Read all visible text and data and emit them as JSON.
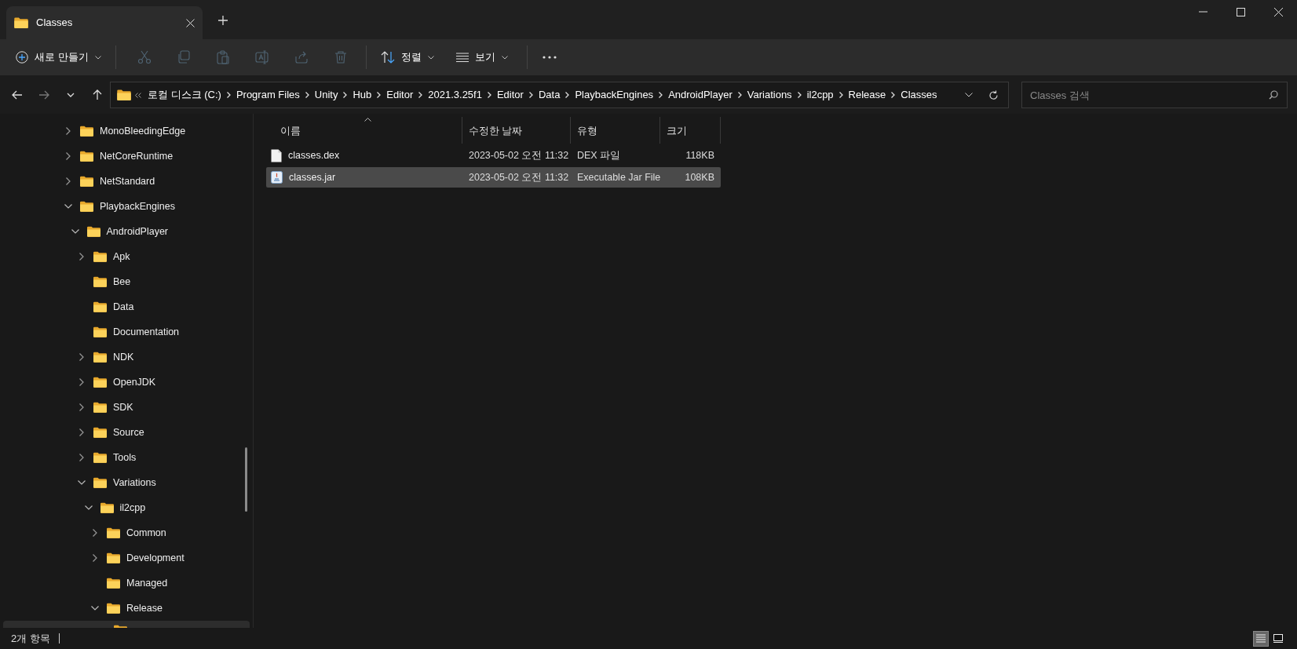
{
  "tabs": [
    {
      "title": "Classes",
      "selected": true
    }
  ],
  "toolbar": {
    "new_button": "새로 만들기",
    "actions": [
      {
        "kind": "cut",
        "disabled": true
      },
      {
        "kind": "copy",
        "disabled": true
      },
      {
        "kind": "paste",
        "disabled": true
      },
      {
        "kind": "rename",
        "disabled": true
      },
      {
        "kind": "share",
        "disabled": true
      },
      {
        "kind": "delete",
        "disabled": true
      }
    ],
    "sort_button": "정렬",
    "view_button": "보기"
  },
  "navigation": {
    "back": {
      "disabled": false
    },
    "forward": {
      "disabled": true
    }
  },
  "address_bar": {
    "crumbs": [
      "로컬 디스크 (C:)",
      "Program Files",
      "Unity",
      "Hub",
      "Editor",
      "2021.3.25f1",
      "Editor",
      "Data",
      "PlaybackEngines",
      "AndroidPlayer",
      "Variations",
      "il2cpp",
      "Release",
      "Classes"
    ]
  },
  "search": {
    "placeholder": "Classes 검색"
  },
  "sidebar": {
    "items": [
      {
        "label": "MonoBleedingEdge",
        "expandable": true,
        "expanded": false,
        "selected": false
      },
      {
        "label": "NetCoreRuntime",
        "expandable": true,
        "expanded": false,
        "selected": false
      },
      {
        "label": "NetStandard",
        "expandable": true,
        "expanded": false,
        "selected": false
      },
      {
        "label": "PlaybackEngines",
        "expandable": true,
        "expanded": true,
        "selected": false,
        "children": [
          {
            "label": "AndroidPlayer",
            "expandable": true,
            "expanded": true,
            "selected": false,
            "children": [
              {
                "label": "Apk",
                "expandable": true,
                "expanded": false,
                "selected": false
              },
              {
                "label": "Bee",
                "expandable": false,
                "selected": false
              },
              {
                "label": "Data",
                "expandable": false,
                "selected": false
              },
              {
                "label": "Documentation",
                "expandable": false,
                "selected": false
              },
              {
                "label": "NDK",
                "expandable": true,
                "expanded": false,
                "selected": false
              },
              {
                "label": "OpenJDK",
                "expandable": true,
                "expanded": false,
                "selected": false
              },
              {
                "label": "SDK",
                "expandable": true,
                "expanded": false,
                "selected": false
              },
              {
                "label": "Source",
                "expandable": true,
                "expanded": false,
                "selected": false
              },
              {
                "label": "Tools",
                "expandable": true,
                "expanded": false,
                "selected": false
              },
              {
                "label": "Variations",
                "expandable": true,
                "expanded": true,
                "selected": false,
                "children": [
                  {
                    "label": "il2cpp",
                    "expandable": true,
                    "expanded": true,
                    "selected": false,
                    "children": [
                      {
                        "label": "Common",
                        "expandable": true,
                        "expanded": false,
                        "selected": false
                      },
                      {
                        "label": "Development",
                        "expandable": true,
                        "expanded": false,
                        "selected": false
                      },
                      {
                        "label": "Managed",
                        "expandable": false,
                        "selected": false
                      },
                      {
                        "label": "Release",
                        "expandable": true,
                        "expanded": true,
                        "selected": false,
                        "children": [
                          {
                            "expandable": false,
                            "selected": true
                          }
                        ]
                      }
                    ]
                  }
                ]
              }
            ]
          }
        ]
      }
    ]
  },
  "file_list": {
    "columns": [
      {
        "label": "이름",
        "sorted": true
      },
      {
        "label": "수정한 날짜",
        "sorted": false
      },
      {
        "label": "유형",
        "sorted": false
      },
      {
        "label": "크기",
        "sorted": false
      }
    ],
    "rows": [
      {
        "kind": "file",
        "name": "classes.dex",
        "date": "2023-05-02 오전 11:32",
        "type": "DEX 파일",
        "size": "118KB",
        "selected": false
      },
      {
        "kind": "jar",
        "name": "classes.jar",
        "date": "2023-05-02 오전 11:32",
        "type": "Executable Jar File",
        "size": "108KB",
        "selected": true
      }
    ]
  },
  "status_bar": {
    "count": "2개 항목",
    "views": [
      {
        "kind": "details",
        "selected": true
      },
      {
        "kind": "tiles",
        "selected": false
      }
    ]
  }
}
